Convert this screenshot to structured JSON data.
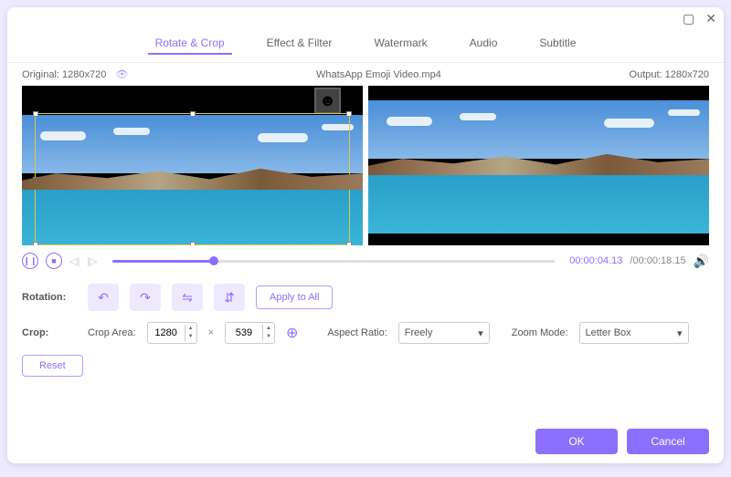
{
  "tabs": {
    "rotate_crop": "Rotate & Crop",
    "effect_filter": "Effect & Filter",
    "watermark": "Watermark",
    "audio": "Audio",
    "subtitle": "Subtitle"
  },
  "info": {
    "original_label": "Original:",
    "original_res": "1280x720",
    "filename": "WhatsApp Emoji Video.mp4",
    "output_label": "Output:",
    "output_res": "1280x720"
  },
  "playback": {
    "current": "00:00:04.13",
    "total": "/00:00:18.15"
  },
  "rotation": {
    "label": "Rotation:",
    "apply_all": "Apply to All"
  },
  "crop": {
    "label": "Crop:",
    "area_label": "Crop Area:",
    "width": "1280",
    "height": "539",
    "aspect_label": "Aspect Ratio:",
    "aspect_value": "Freely",
    "zoom_label": "Zoom Mode:",
    "zoom_value": "Letter Box",
    "reset": "Reset"
  },
  "footer": {
    "ok": "OK",
    "cancel": "Cancel"
  }
}
